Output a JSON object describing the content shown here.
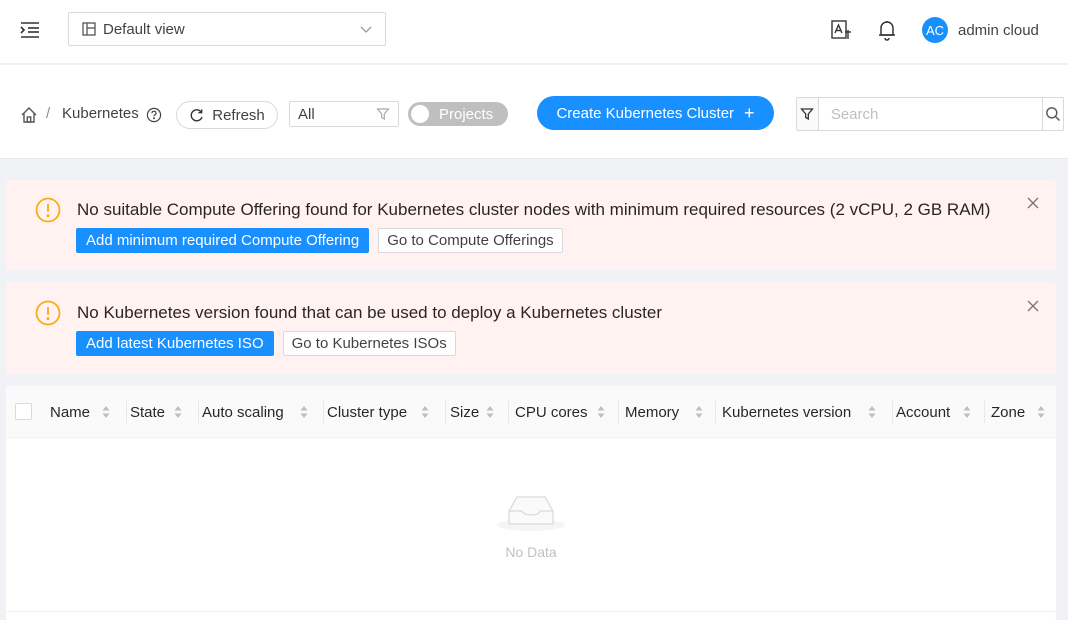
{
  "header": {
    "view_selector": {
      "value": "Default view"
    },
    "user": {
      "initials": "AC",
      "name": "admin cloud"
    }
  },
  "toolbar": {
    "breadcrumb_separator": "/",
    "page_title": "Kubernetes",
    "refresh_label": "Refresh",
    "filter_value": "All",
    "projects_toggle_label": "Projects",
    "projects_toggle_on": false,
    "create_label": "Create Kubernetes Cluster",
    "search_placeholder": "Search"
  },
  "alerts": [
    {
      "message": "No suitable Compute Offering found for Kubernetes cluster nodes with minimum required resources (2 vCPU, 2 GB RAM)",
      "primary_action": "Add minimum required Compute Offering",
      "secondary_action": "Go to Compute Offerings"
    },
    {
      "message": "No Kubernetes version found that can be used to deploy a Kubernetes cluster",
      "primary_action": "Add latest Kubernetes ISO",
      "secondary_action": "Go to Kubernetes ISOs"
    }
  ],
  "table": {
    "columns": [
      "Name",
      "State",
      "Auto scaling",
      "Cluster type",
      "Size",
      "CPU cores",
      "Memory",
      "Kubernetes version",
      "Account",
      "Zone"
    ],
    "rows": [],
    "empty_text": "No Data"
  },
  "colors": {
    "primary": "#1890ff",
    "alert_background": "#fff2f0",
    "warning_icon": "#faad14"
  }
}
